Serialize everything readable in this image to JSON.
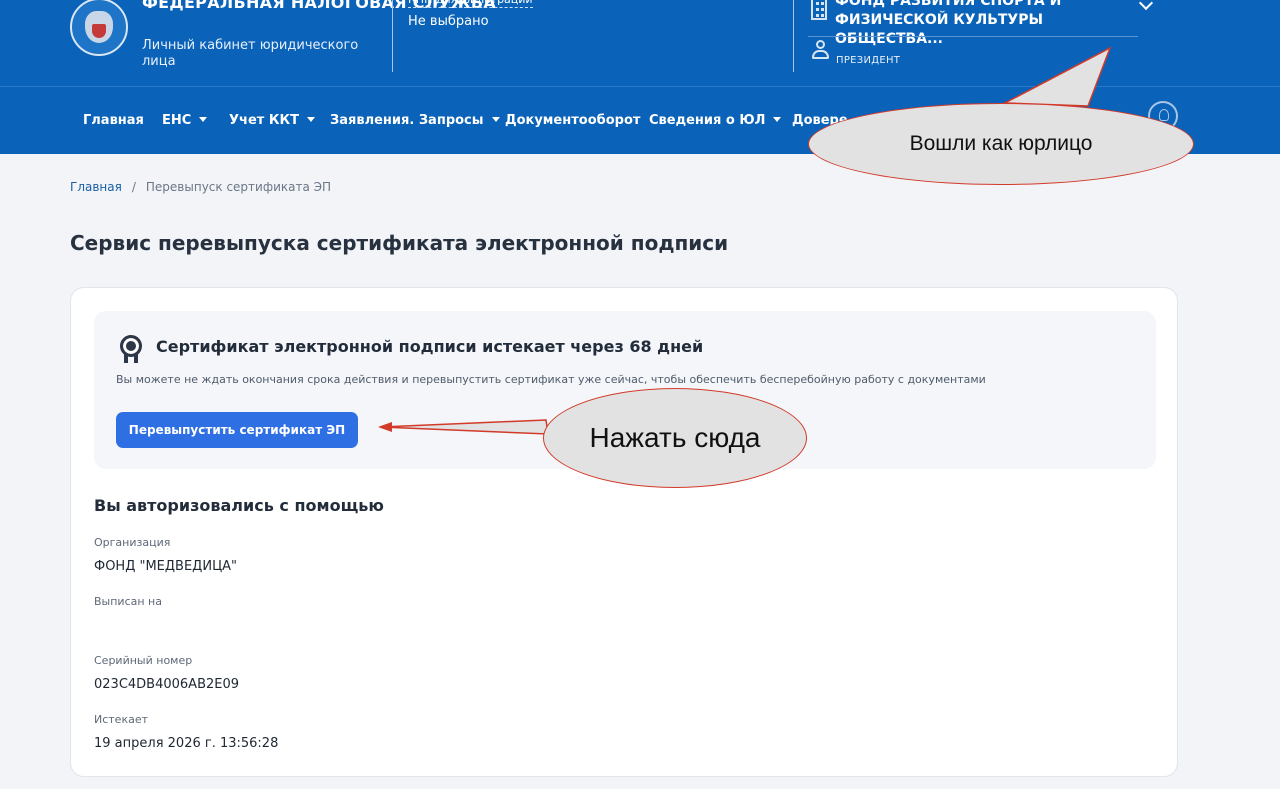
{
  "header": {
    "brand_title": "Федеральная налоговая служба",
    "brand_subtitle": "Личный кабинет юридического лица",
    "filter_label": "КПП для фильтрации",
    "filter_value": "Не выбрано",
    "org_name": "Фонд развития спорта и физической культуры общества...",
    "user_role": "ПРЕЗИДЕНТ"
  },
  "nav": {
    "items": [
      {
        "label": "Главная",
        "dropdown": false
      },
      {
        "label": "ЕНС",
        "dropdown": true
      },
      {
        "label": "Учет ККТ",
        "dropdown": true
      },
      {
        "label": "Заявления. Запросы",
        "dropdown": true
      },
      {
        "label": "Документооборот",
        "dropdown": false
      },
      {
        "label": "Сведения о ЮЛ",
        "dropdown": true
      },
      {
        "label": "Довере",
        "dropdown": false
      }
    ],
    "icon": "lightbulb-icon"
  },
  "breadcrumb": {
    "home": "Главная",
    "separator": "/",
    "current": "Перевыпуск сертификата ЭП"
  },
  "page_title": "Сервис перевыпуска сертификата электронной подписи",
  "notice": {
    "icon": "medal-icon",
    "title": "Сертификат электронной подписи истекает через 68 дней",
    "description": "Вы можете не ждать окончания срока действия и перевыпустить сертификат уже сейчас, чтобы обеспечить бесперебойную работу с документами",
    "button_label": "Перевыпустить сертификат ЭП"
  },
  "auth": {
    "title": "Вы авторизовались с помощью",
    "fields": [
      {
        "label": "Организация",
        "value": "ФОНД \"МЕДВЕДИЦА\""
      },
      {
        "label": "Выписан на",
        "value": ""
      },
      {
        "label": "Серийный номер",
        "value": "023C4DB4006AB2E09"
      },
      {
        "label": "Истекает",
        "value": "19 апреля 2026 г. 13:56:28"
      }
    ]
  },
  "annotations": {
    "callout_logged_in": "Вошли как юрлицо",
    "callout_click_here": "Нажать сюда",
    "color": "#d23a2a"
  },
  "colors": {
    "header_bg": "#0a63b8",
    "button_bg": "#2f6fe4"
  }
}
